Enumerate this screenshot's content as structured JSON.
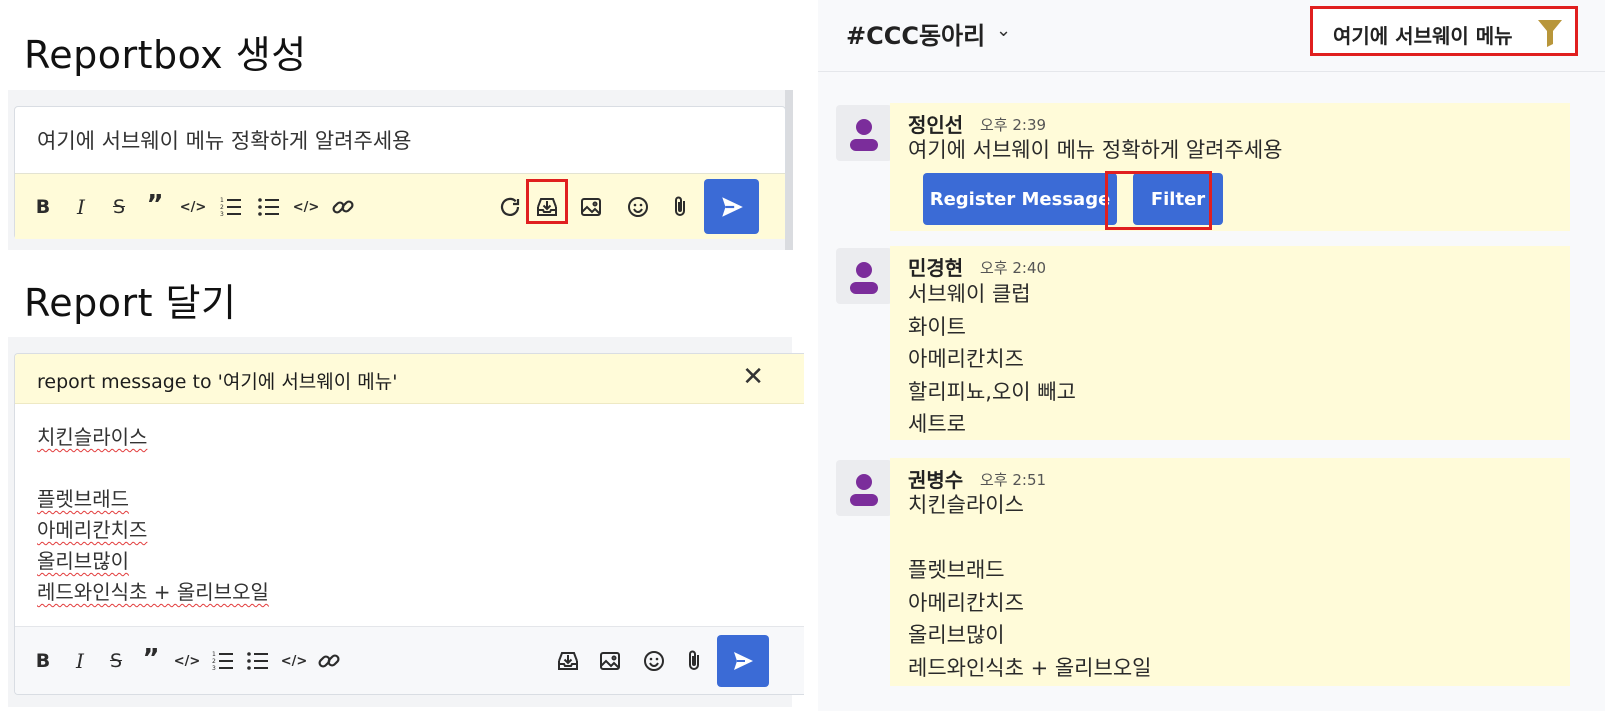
{
  "sections": {
    "create_title": "Reportbox 생성",
    "reply_title": "Report 달기"
  },
  "composer1": {
    "input_text": "여기에 서브웨이 메뉴 정확하게 알려주세용",
    "icons": [
      "bold-icon",
      "italic-icon",
      "strikethrough-icon",
      "quote-icon",
      "inline-code-icon",
      "ordered-list-icon",
      "bullet-list-icon",
      "code-block-icon",
      "link-icon",
      "refresh-icon",
      "reportbox-icon",
      "image-icon",
      "emoji-icon",
      "attach-icon",
      "send-icon"
    ]
  },
  "composer2": {
    "reply_label": "report message to '여기에 서브웨이 메뉴'",
    "close_glyph": "✕",
    "lines": [
      "치킨슬라이스",
      "",
      "플렛브래드",
      "아메리칸치즈",
      "올리브많이",
      "레드와인식초 + 올리브오일"
    ],
    "icons": [
      "bold-icon",
      "italic-icon",
      "strikethrough-icon",
      "quote-icon",
      "inline-code-icon",
      "ordered-list-icon",
      "bullet-list-icon",
      "code-block-icon",
      "link-icon",
      "reportbox-icon",
      "image-icon",
      "emoji-icon",
      "attach-icon",
      "send-icon"
    ]
  },
  "chat": {
    "channel": "#CCC동아리",
    "chevron": "⌄",
    "filter_label": "여기에 서브웨이 메뉴",
    "messages": [
      {
        "author": "정인선",
        "time": "오후 2:39",
        "lines": [
          "여기에 서브웨이 메뉴 정확하게 알려주세용"
        ],
        "buttons": [
          "Register Message",
          "Filter"
        ]
      },
      {
        "author": "민경현",
        "time": "오후 2:40",
        "lines": [
          "서브웨이 클럽",
          "화이트",
          "아메리칸치즈",
          "할리피뇨,오이 빼고",
          "세트로"
        ]
      },
      {
        "author": "권병수",
        "time": "오후 2:51",
        "lines": [
          "치킨슬라이스",
          "",
          "플렛브래드",
          "아메리칸치즈",
          "올리브많이",
          "레드와인식초 + 올리브오일"
        ]
      }
    ]
  },
  "colors": {
    "accent": "#3b6bd6",
    "highlight": "#fffbd9",
    "annotation_red": "#e01f1f",
    "avatar_purple": "#7b2d9b",
    "funnel": "#b8963a"
  }
}
